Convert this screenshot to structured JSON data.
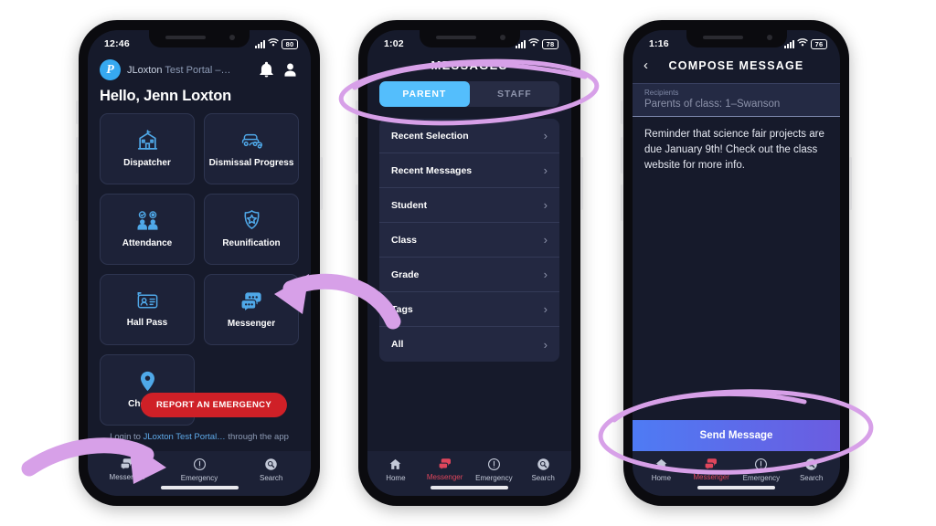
{
  "phones": {
    "phone1": {
      "status": {
        "time": "12:46",
        "wifi": "wifi-icon",
        "battery": "80"
      },
      "portal_name_bold": "JLoxton",
      "portal_name_rest": " Test Portal –…",
      "greeting": "Hello, Jenn Loxton",
      "tiles": [
        {
          "label": "Dispatcher",
          "icon": "school-building-icon"
        },
        {
          "label": "Dismissal Progress",
          "icon": "cars-icon"
        },
        {
          "label": "Attendance",
          "icon": "two-people-check-icon"
        },
        {
          "label": "Reunification",
          "icon": "police-badge-icon"
        },
        {
          "label": "Hall Pass",
          "icon": "id-card-icon"
        },
        {
          "label": "Messenger",
          "icon": "chat-bubbles-icon"
        },
        {
          "label": "Check In",
          "icon": "map-pin-icon"
        }
      ],
      "emergency_pill": "REPORT AN EMERGENCY",
      "login_note_prefix": "Login to ",
      "login_note_bold": "JLoxton  Test Portal…",
      "login_note_suffix": " through the app",
      "tabs": [
        {
          "label": "Messenger",
          "icon": "chat-bubbles-icon",
          "active": false
        },
        {
          "label": "Emergency",
          "icon": "alert-circle-icon",
          "active": false
        },
        {
          "label": "Search",
          "icon": "search-icon",
          "active": false
        }
      ]
    },
    "phone2": {
      "status": {
        "time": "1:02",
        "wifi": "wifi-icon",
        "battery": "78"
      },
      "title": "MESSAGES",
      "segments": [
        {
          "label": "PARENT",
          "selected": true
        },
        {
          "label": "STAFF",
          "selected": false
        }
      ],
      "list": [
        {
          "label": "Recent Selection"
        },
        {
          "label": "Recent Messages"
        },
        {
          "label": "Student"
        },
        {
          "label": "Class"
        },
        {
          "label": "Grade"
        },
        {
          "label": "Tags"
        },
        {
          "label": "All"
        }
      ],
      "chevron": "›",
      "tabs": [
        {
          "label": "Home",
          "icon": "home-icon",
          "active": false
        },
        {
          "label": "Messenger",
          "icon": "chat-bubbles-icon",
          "active": true
        },
        {
          "label": "Emergency",
          "icon": "alert-circle-icon",
          "active": false
        },
        {
          "label": "Search",
          "icon": "search-icon",
          "active": false
        }
      ]
    },
    "phone3": {
      "status": {
        "time": "1:16",
        "wifi": "wifi-icon",
        "battery": "76"
      },
      "back": "‹",
      "title": "COMPOSE MESSAGE",
      "recipients_label": "Recipients",
      "recipients_value": "Parents of class: 1–Swanson",
      "message_body": "Reminder that science fair projects are due January 9th! Check out the class website for more info.",
      "send_label": "Send Message",
      "tabs": [
        {
          "label": "Home",
          "icon": "home-icon",
          "active": false
        },
        {
          "label": "Messenger",
          "icon": "chat-bubbles-icon",
          "active": true
        },
        {
          "label": "Emergency",
          "icon": "alert-circle-icon",
          "active": false
        },
        {
          "label": "Search",
          "icon": "search-icon",
          "active": false
        }
      ]
    }
  },
  "annotations": {
    "ellipse_messages_tabs": "highlight-ellipse",
    "ellipse_send_message": "highlight-ellipse",
    "arrow_to_messenger_tile": "curved-arrow-left",
    "arrow_to_messenger_tab": "curved-arrow-right"
  },
  "colors": {
    "accent_blue": "#54befc",
    "tile_icon_blue": "#4fa8e8",
    "emergency_red": "#cf2027",
    "active_tab_red": "#e0465c",
    "annotation_purple": "#d7a0e8",
    "send_gradient_start": "#4e7bf4",
    "send_gradient_end": "#6b5ce0",
    "screen_bg": "#161a2b"
  }
}
